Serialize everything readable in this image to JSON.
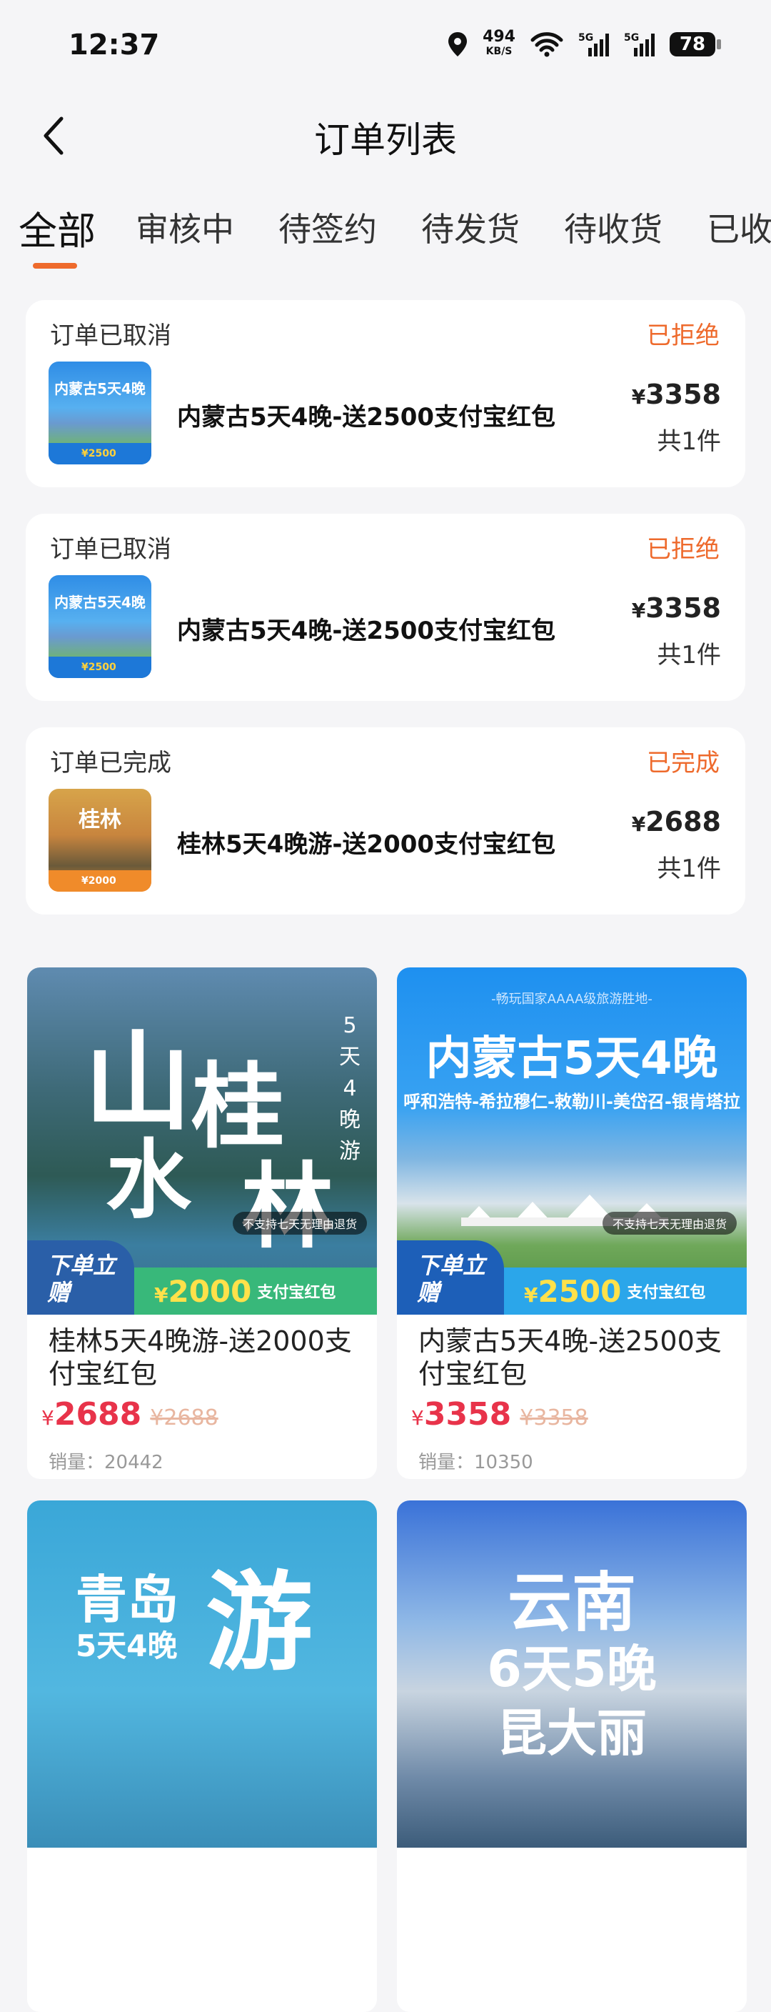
{
  "status_bar": {
    "time": "12:37",
    "speed": "494",
    "speed_unit": "KB/S",
    "net1": "5G",
    "net2": "5G",
    "battery": "78"
  },
  "nav": {
    "title": "订单列表"
  },
  "tabs": [
    {
      "label": "全部",
      "active": true
    },
    {
      "label": "审核中"
    },
    {
      "label": "待签约"
    },
    {
      "label": "待发货"
    },
    {
      "label": "待收货"
    },
    {
      "label": "已收"
    }
  ],
  "orders": [
    {
      "status": "订单已取消",
      "state": "已拒绝",
      "thumb_title": "内蒙古5天4晚",
      "thumb_foot": "¥2500",
      "product": "内蒙古5天4晚-送2500支付宝红包",
      "currency": "¥",
      "price": "3358",
      "qty": "共1件"
    },
    {
      "status": "订单已取消",
      "state": "已拒绝",
      "thumb_title": "内蒙古5天4晚",
      "thumb_foot": "¥2500",
      "product": "内蒙古5天4晚-送2500支付宝红包",
      "currency": "¥",
      "price": "3358",
      "qty": "共1件"
    },
    {
      "status": "订单已完成",
      "state": "已完成",
      "thumb_title": "桂林",
      "thumb_foot": "¥2000",
      "product": "桂林5天4晚游-送2000支付宝红包",
      "currency": "¥",
      "price": "2688",
      "qty": "共1件"
    }
  ],
  "products": [
    {
      "img_chars_a": "山",
      "img_chars_b": "水",
      "img_chars_c": "桂",
      "img_chars_d": "林",
      "img_vertical": "5天4晚游",
      "refund": "不支持七天无理由退货",
      "promo_left": "下单立赠",
      "promo_amount": "2000",
      "promo_currency": "¥",
      "promo_sub": "支付宝红包",
      "title": "桂林5天4晚游-送2000支付宝红包",
      "currency": "¥",
      "price": "2688",
      "old_price": "¥2688",
      "sales": "销量：20442"
    },
    {
      "tagline": "-畅玩国家AAAA级旅游胜地-",
      "img_title": "内蒙古5天4晚",
      "img_sub": "呼和浩特-希拉穆仁-敕勒川-美岱召-银肯塔拉",
      "refund": "不支持七天无理由退货",
      "promo_left": "下单立赠",
      "promo_amount": "2500",
      "promo_currency": "¥",
      "promo_sub": "支付宝红包",
      "title": "内蒙古5天4晚-送2500支付宝红包",
      "currency": "¥",
      "price": "3358",
      "old_price": "¥3358",
      "sales": "销量：10350"
    },
    {
      "img_title": "青岛",
      "img_big": "游",
      "img_sub": "5天4晚"
    },
    {
      "img_title": "云南",
      "img_sub": "6天5晚",
      "img_sub2": "昆大丽"
    }
  ],
  "colors": {
    "accent": "#ee6a2c",
    "price": "#e8334a",
    "background": "#f5f5f7"
  }
}
